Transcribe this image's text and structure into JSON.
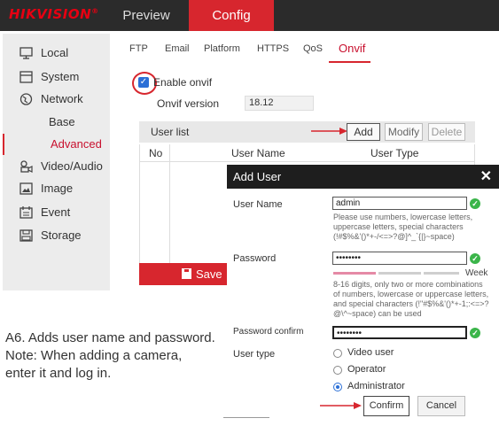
{
  "brand": {
    "logo_text": "HIKVISION",
    "logo_mark": "®",
    "accent": "#d7262e"
  },
  "top_tabs": [
    {
      "label": "Preview",
      "active": false
    },
    {
      "label": "Config",
      "active": true
    }
  ],
  "sidebar": {
    "items": [
      {
        "label": "Local",
        "icon": "monitor-icon"
      },
      {
        "label": "System",
        "icon": "system-icon"
      },
      {
        "label": "Network",
        "icon": "globe-icon"
      },
      {
        "label": "Base",
        "sub": true
      },
      {
        "label": "Advanced",
        "sub": true,
        "active": true
      },
      {
        "label": "Video/Audio",
        "icon": "video-audio-icon"
      },
      {
        "label": "Image",
        "icon": "image-icon"
      },
      {
        "label": "Event",
        "icon": "calendar-icon"
      },
      {
        "label": "Storage",
        "icon": "storage-icon"
      }
    ]
  },
  "sub_tabs": [
    {
      "label": "FTP"
    },
    {
      "label": "Email"
    },
    {
      "label": "Platform"
    },
    {
      "label": "HTTPS"
    },
    {
      "label": "QoS"
    },
    {
      "label": "Onvif",
      "active": true
    }
  ],
  "onvif": {
    "enable_label": "Enable onvif",
    "enabled": true,
    "version_label": "Onvif version",
    "version_value": "18.12"
  },
  "user_list": {
    "title": "User list",
    "buttons": {
      "add": "Add",
      "modify": "Modify",
      "delete": "Delete"
    },
    "columns": [
      "No",
      "User Name",
      "User Type"
    ]
  },
  "save_label": "Save",
  "modal": {
    "title": "Add User",
    "close_glyph": "✕",
    "username_label": "User Name",
    "username_value": "admin",
    "username_hint": "Please use numbers, lowercase letters, uppercase letters, special characters (!#$%&'()*+-/<=>?@]^_`{|}~space)",
    "password_label": "Password",
    "password_value": "••••••••",
    "strength_label": "Week",
    "password_hint": "8-16 digits, only two or more combinations of numbers, lowercase or uppercase letters, and special characters (!\"#$%&'()*+-1;:<=>?@\\^~space) can be used",
    "confirm_label": "Password confirm",
    "confirm_value": "••••••••",
    "usertype_label": "User type",
    "user_types": [
      {
        "label": "Video user",
        "selected": false
      },
      {
        "label": "Operator",
        "selected": false
      },
      {
        "label": "Administrator",
        "selected": true
      }
    ],
    "confirm_button": "Confirm",
    "cancel_button": "Cancel"
  },
  "caption": {
    "line1": "A6.  Adds user name and password.",
    "line2": "Note: When adding a camera,",
    "line3": "enter it and log in."
  }
}
